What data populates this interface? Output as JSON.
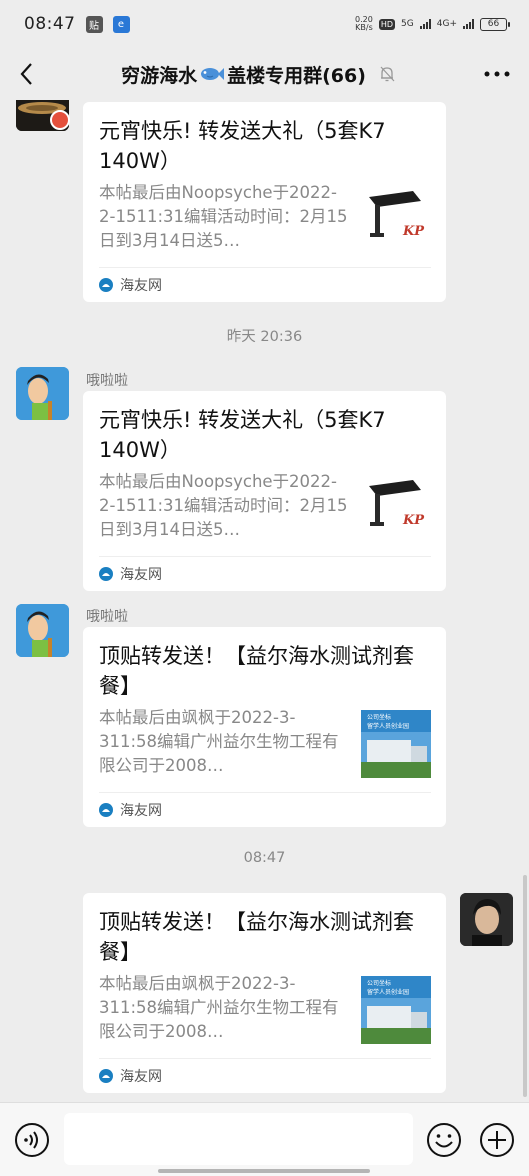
{
  "status_bar": {
    "time": "08:47",
    "app_icon_1": "贴",
    "app_icon_2": "e",
    "net_speed": "0.20",
    "net_unit": "KB/s",
    "hd_label": "HD",
    "net_5g": "5G",
    "net_4g": "4G+",
    "battery": "66"
  },
  "nav": {
    "title_part1": "穷游海水",
    "title_part2": "盖楼专用群(66)",
    "icons": [
      "back-arrow-icon",
      "fish-icon",
      "bell-muted-icon",
      "more-icon"
    ]
  },
  "messages": [
    {
      "title": "元宵快乐! 转发送大礼（5套K7 140W）",
      "desc": "本帖最后由Noopsyche于2022-2-1511:31编辑活动时间：2月15日到3月14日送5…",
      "source": "海友网"
    },
    {
      "sender": "哦啦啦",
      "title": "元宵快乐! 转发送大礼（5套K7 140W）",
      "desc": "本帖最后由Noopsyche于2022-2-1511:31编辑活动时间：2月15日到3月14日送5…",
      "source": "海友网"
    },
    {
      "sender": "哦啦啦",
      "title": "顶贴转发送！【益尔海水测试剂套餐】",
      "desc": "本帖最后由飒枫于2022-3-311:58编辑广州益尔生物工程有限公司于2008…",
      "source": "海友网",
      "thumb_caption_1": "公司坐标",
      "thumb_caption_2": "留学人员创业园"
    },
    {
      "title": "顶贴转发送！【益尔海水测试剂套餐】",
      "desc": "本帖最后由飒枫于2022-3-311:58编辑广州益尔生物工程有限公司于2008…",
      "source": "海友网",
      "thumb_caption_1": "公司坐标",
      "thumb_caption_2": "留学人员创业园"
    }
  ],
  "timestamps": [
    "昨天 20:36",
    "08:47"
  ],
  "thumb_logo": "KP",
  "input_bar": {
    "placeholder": "",
    "icons": [
      "voice-icon",
      "emoji-icon",
      "plus-icon"
    ]
  },
  "colors": {
    "background": "#ededed",
    "card": "#ffffff",
    "source_icon": "#1a7fc1",
    "self_avatar": "#1c1c1c"
  }
}
